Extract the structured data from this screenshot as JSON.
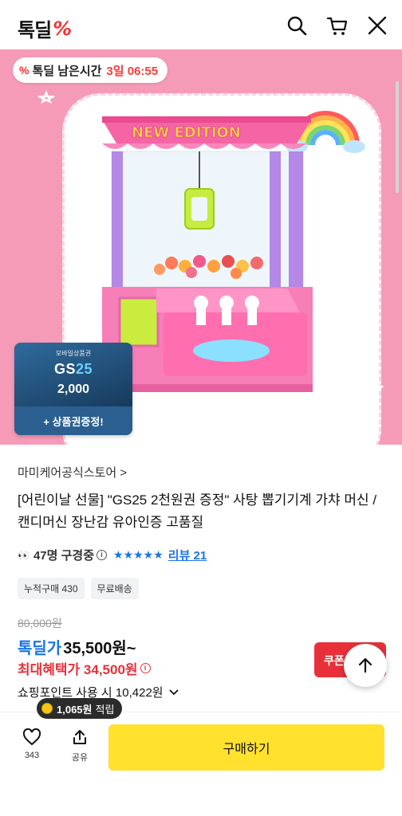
{
  "header": {
    "logo_text": "톡딜",
    "logo_mark": "%"
  },
  "hero": {
    "timer_logo": "%",
    "timer_label": "톡딜 남은시간",
    "timer_value": "3일 06:55",
    "machine_sign": "NEW EDITION",
    "voucher": {
      "top": "모바일상품권",
      "brand_a": "GS",
      "brand_b": "25",
      "amount": "2,000",
      "gift": "+ 상품권증정!"
    }
  },
  "product": {
    "store": "마미케어공식스토어 >",
    "title": "[어린이날 선물] \"GS25 2천원권 증정\" 사탕 뽑기기계 가챠 머신 / 캔디머신 장난감 유아인증 고품질",
    "buyers": "47명 구경중",
    "stars": "★★★★★",
    "review": "리뷰 21",
    "tags": [
      "누적구매 430",
      "무료배송"
    ],
    "original_price": "80,000원",
    "deal_label": "톡딜가",
    "deal_price": "35,500원~",
    "best_label": "최대혜택가 34,500원",
    "points": "쇼핑포인트 사용 시 10,422원",
    "coupon": "쿠폰",
    "reward_amount": "1,065원",
    "reward_label": "적립"
  },
  "bottom": {
    "like_count": "343",
    "share_label": "공유",
    "buy_label": "구매하기"
  },
  "colors": {
    "accent_red": "#ff2d2d",
    "deal_blue": "#1a74e8",
    "buy_yellow": "#ffe12e",
    "hero_pink": "#f59bb8"
  }
}
